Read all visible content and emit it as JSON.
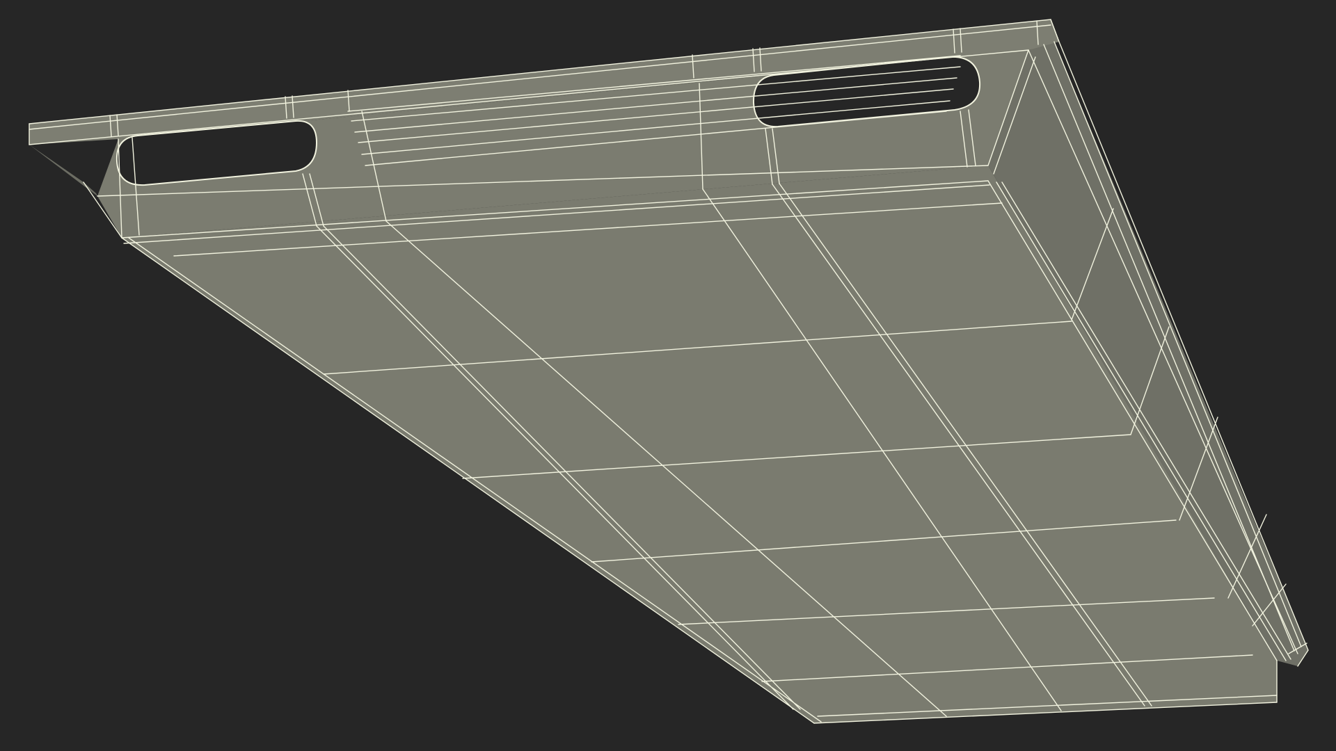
{
  "scene": {
    "background_color": "#262626",
    "surface_color": "#7a7b6f",
    "surface_shade_color": "#6f7066",
    "wire_color": "#f2f3df",
    "subject": "wireframe-tray-model",
    "handle_slots": 2
  }
}
